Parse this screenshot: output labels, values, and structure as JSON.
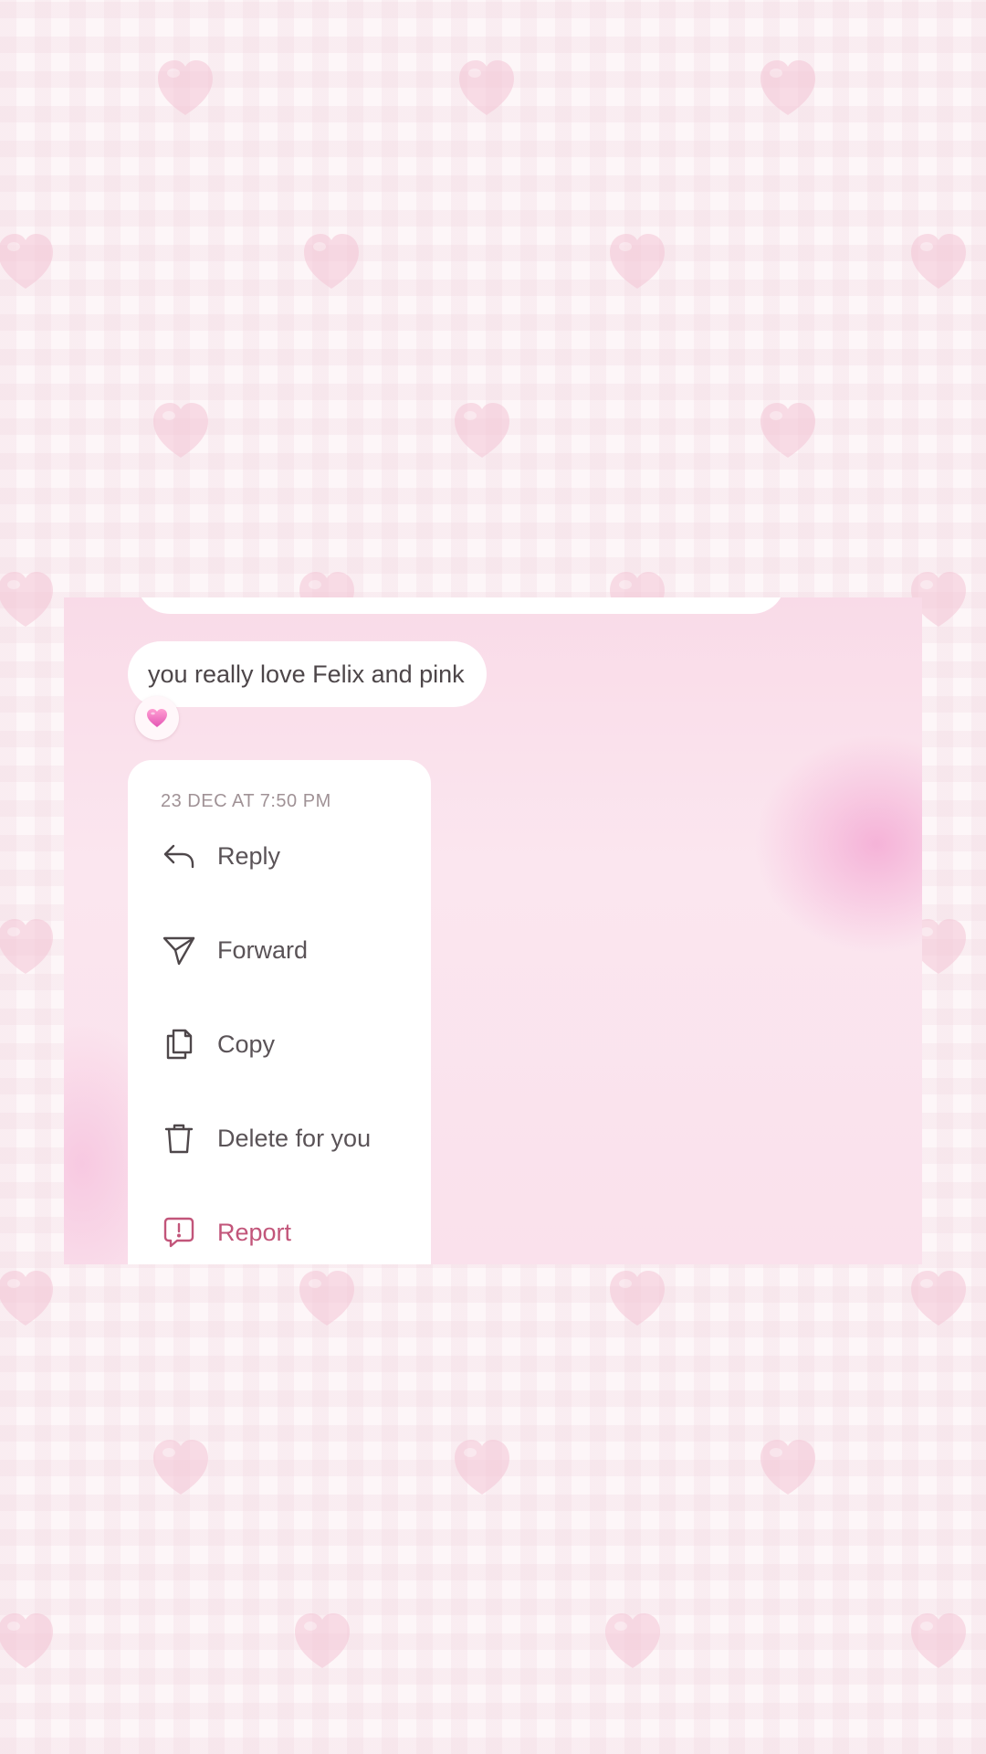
{
  "message": {
    "text": "you really love Felix and pink",
    "reaction": "pink-heart-emoji"
  },
  "menu": {
    "timestamp": "23 DEC AT 7:50 PM",
    "items": [
      {
        "label": "Reply",
        "icon": "reply-arrow-icon"
      },
      {
        "label": "Forward",
        "icon": "paper-plane-icon"
      },
      {
        "label": "Copy",
        "icon": "copy-icon"
      },
      {
        "label": "Delete for you",
        "icon": "trash-icon"
      },
      {
        "label": "Report",
        "icon": "report-icon"
      }
    ]
  },
  "colors": {
    "background": "#fdf6f8",
    "panel_pink": "#f9dbe8",
    "accent_pink": "#f4aad4",
    "report_red": "#c2557a",
    "heart_pink": "#f5c6d6"
  }
}
